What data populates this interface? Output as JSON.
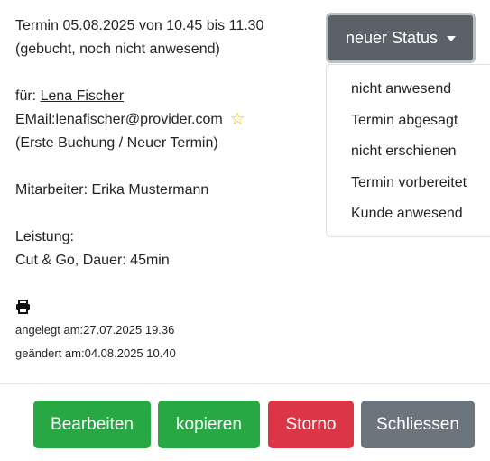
{
  "appointment": {
    "time_line": "Termin 05.08.2025 von 10.45 bis 11.30",
    "state_line": "(gebucht, noch nicht anwesend)",
    "for_label": "für: ",
    "customer_name": "Lena Fischer",
    "email_line": "EMail:lenafischer@provider.com",
    "booking_note": "(Erste Buchung / Neuer Termin)",
    "employee_line": "Mitarbeiter: Erika Mustermann",
    "service_label": "Leistung:",
    "service_line": "Cut & Go, Dauer: 45min",
    "created_line": "angelegt am:27.07.2025 19.36",
    "changed_line": "geändert am:04.08.2025 10.40"
  },
  "status_menu": {
    "button_label": "neuer Status",
    "items": [
      "nicht anwesend",
      "Termin abgesagt",
      "nicht erschienen",
      "Termin vorbereitet",
      "Kunde anwesend"
    ]
  },
  "footer": {
    "edit_label": "Bearbeiten",
    "copy_label": "kopieren",
    "storno_label": "Storno",
    "close_label": "Schliessen"
  },
  "icons": {
    "favorite": "star-icon",
    "print": "printer-icon",
    "dropdown": "caret-down-icon"
  },
  "colors": {
    "success": "#28a745",
    "danger": "#dc3545",
    "secondary": "#6c757d",
    "status_button": "#5a6268",
    "star": "#f2c200"
  }
}
